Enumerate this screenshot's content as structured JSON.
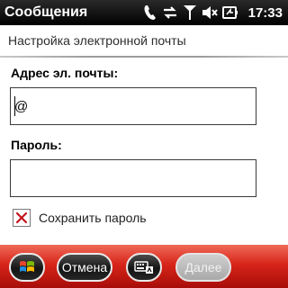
{
  "status_bar": {
    "app_title": "Сообщения",
    "clock": "17:33",
    "icons": [
      "phone-icon",
      "sync-icon",
      "signal-icon",
      "speaker-muted-icon",
      "battery-charging-icon"
    ]
  },
  "screen": {
    "title": "Настройка электронной почты"
  },
  "form": {
    "email_label": "Адрес эл. почты:",
    "email_value": "@",
    "password_label": "Пароль:",
    "password_value": "",
    "save_password_label": "Сохранить пароль",
    "save_password_checked": true
  },
  "softkeys": {
    "start_icon": "windows-flag-icon",
    "cancel_label": "Отмена",
    "keyboard_icon": "keyboard-icon",
    "next_label": "Далее",
    "next_enabled": false
  },
  "colors": {
    "softkey_bar": "#d7251a",
    "checkbox_mark": "#c4151c",
    "title_bar": "#000000"
  }
}
